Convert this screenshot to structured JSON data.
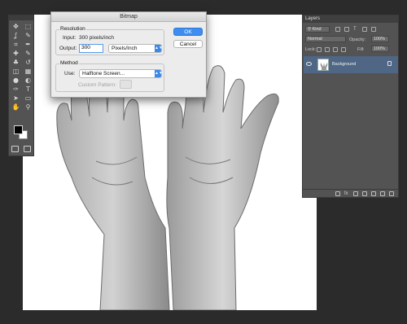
{
  "dialog": {
    "title": "Bitmap",
    "resolution_label": "Resolution",
    "input_label": "Input:",
    "input_value": "300 pixels/inch",
    "output_label": "Output:",
    "output_value": "300",
    "output_unit": "Pixels/Inch",
    "method_label": "Method",
    "use_label": "Use:",
    "use_value": "Halftone Screen...",
    "custom_pattern_label": "Custom Pattern:",
    "ok_label": "OK",
    "cancel_label": "Cancel"
  },
  "layers": {
    "tab_label": "Layers",
    "filter_kind": "Kind",
    "blend_mode": "Normal",
    "opacity_label": "Opacity:",
    "opacity_value": "100%",
    "lock_label": "Lock:",
    "fill_label": "Fill:",
    "fill_value": "100%",
    "layer_name": "Background"
  },
  "colors": {
    "accent": "#3d8ef0",
    "selected_layer": "#4f6684",
    "panel": "#535353",
    "workspace": "#2b2b2b"
  },
  "tools": {
    "icons": [
      "move-icon",
      "marquee-icon",
      "lasso-icon",
      "quick-select-icon",
      "crop-icon",
      "eyedropper-icon",
      "healing-icon",
      "brush-icon",
      "stamp-icon",
      "history-brush-icon",
      "eraser-icon",
      "gradient-icon",
      "blur-icon",
      "dodge-icon",
      "pen-icon",
      "type-icon",
      "path-select-icon",
      "shape-icon",
      "hand-icon",
      "zoom-icon"
    ],
    "glyphs": [
      "✥",
      "⬚",
      "ʆ",
      "✎",
      "⌗",
      "✒",
      "✚",
      "✎",
      "♣",
      "↺",
      "◫",
      "▦",
      "●",
      "◐",
      "✑",
      "T",
      "➤",
      "▭",
      "✋",
      "⚲"
    ]
  }
}
